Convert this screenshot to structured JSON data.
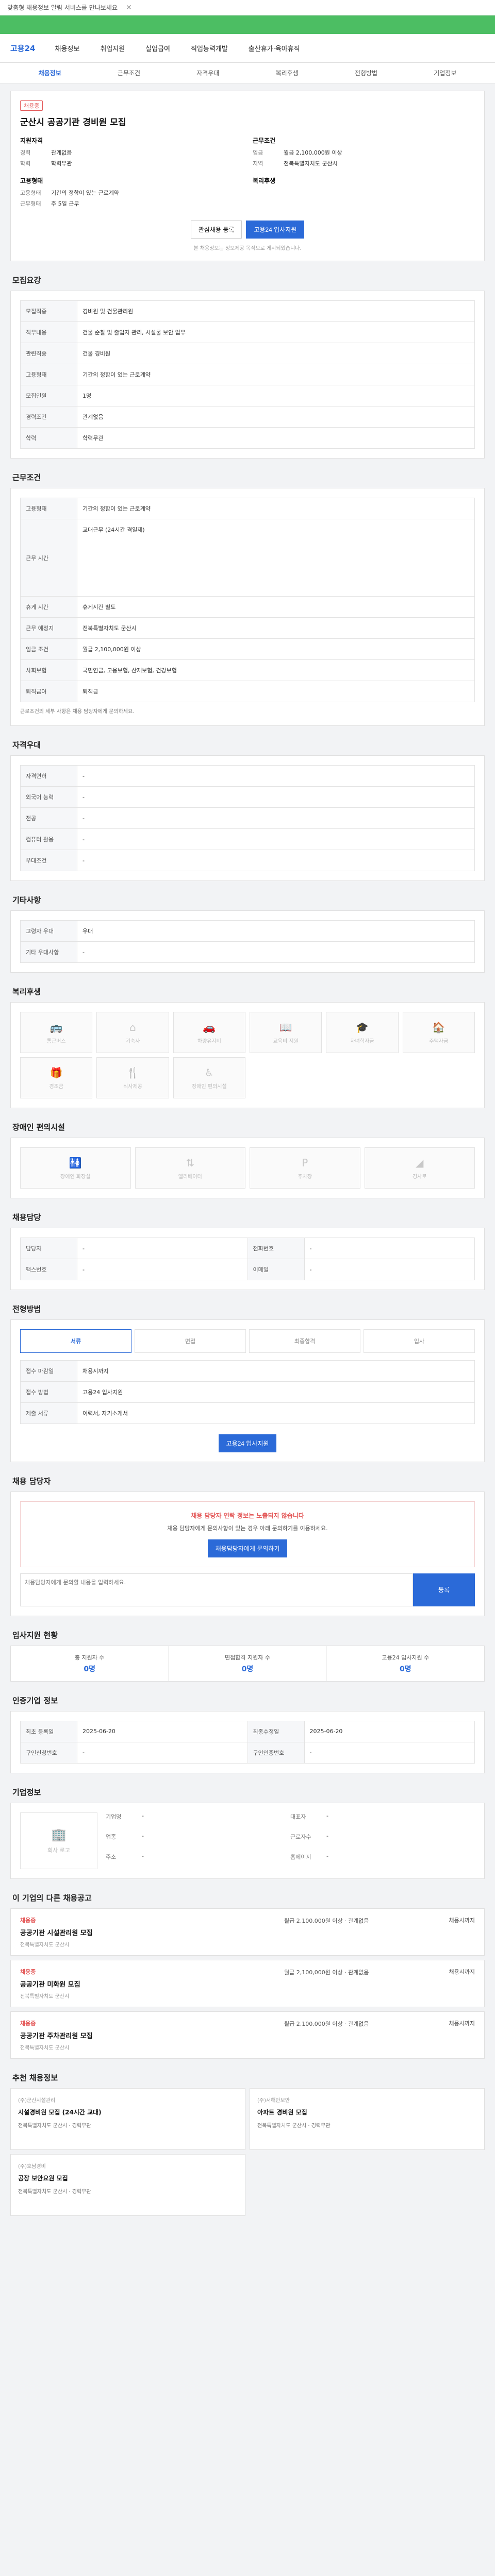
{
  "topbar": {
    "notice": "맞춤형 채용정보 알림 서비스를 만나보세요",
    "close": "✕"
  },
  "nav": {
    "logo": "고용24",
    "menus": [
      "채용정보",
      "취업지원",
      "실업급여",
      "직업능력개발",
      "출산휴가·육아휴직"
    ]
  },
  "subnav": {
    "items": [
      "채용정보",
      "근무조건",
      "자격우대",
      "복리후생",
      "전형방법",
      "기업정보"
    ],
    "active": 0
  },
  "job": {
    "badge": "채용중",
    "title": "군산시 공공기관 경비원 모집",
    "left_title": "지원자격",
    "left_rows": [
      {
        "k": "경력",
        "v": "관계없음"
      },
      {
        "k": "학력",
        "v": "학력무관"
      }
    ],
    "right_title": "근무조건",
    "right_rows": [
      {
        "k": "임금",
        "v": "월급 2,100,000원 이상"
      },
      {
        "k": "지역",
        "v": "전북특별자치도 군산시"
      }
    ],
    "left_title2": "고용형태",
    "left_rows2": [
      {
        "k": "고용형태",
        "v": "기간의 정함이 있는 근로계약"
      },
      {
        "k": "근무형태",
        "v": "주 5일 근무"
      }
    ],
    "right_title2": "복리후생",
    "btn_scrap": "관심채용 등록",
    "btn_apply": "고용24 입사지원",
    "note": "본 채용정보는 정보제공 목적으로 게시되었습니다."
  },
  "recruit": {
    "title": "모집요강",
    "rows": [
      {
        "k": "모집직종",
        "v": "경비원 및 건물관리원"
      },
      {
        "k": "직무내용",
        "v": "건물 순찰 및 출입자 관리, 시설물 보안 업무"
      },
      {
        "k": "관련직종",
        "v": "건물 경비원"
      },
      {
        "k": "고용형태",
        "v": "기간의 정함이 있는 근로계약"
      },
      {
        "k": "모집인원",
        "v": "1명"
      },
      {
        "k": "경력조건",
        "v": "관계없음"
      },
      {
        "k": "학력",
        "v": "학력무관"
      }
    ]
  },
  "conditions": {
    "title": "근무조건",
    "rows": [
      {
        "k": "고용형태",
        "v": "기간의 정함이 있는 근로계약"
      },
      {
        "k": "근무 시간",
        "v": "교대근무 (24시간 격일제)"
      },
      {
        "k": "휴게 시간",
        "v": "휴게시간 별도"
      },
      {
        "k": "근무 예정지",
        "v": "전북특별자치도 군산시"
      },
      {
        "k": "임금 조건",
        "v": "월급 2,100,000원 이상"
      },
      {
        "k": "사회보험",
        "v": "국민연금, 고용보험, 산재보험, 건강보험"
      },
      {
        "k": "퇴직급여",
        "v": "퇴직금"
      }
    ],
    "note": "근로조건의 세부 사항은 채용 담당자에게 문의하세요."
  },
  "qualification": {
    "title": "자격우대",
    "rows": [
      {
        "k": "자격면허",
        "v": "-"
      },
      {
        "k": "외국어 능력",
        "v": "-"
      },
      {
        "k": "전공",
        "v": "-"
      },
      {
        "k": "컴퓨터 활용",
        "v": "-"
      },
      {
        "k": "우대조건",
        "v": "-"
      }
    ]
  },
  "other": {
    "title": "기타사항",
    "rows": [
      {
        "k": "고령자 우대",
        "v": "우대"
      },
      {
        "k": "기타 우대사항",
        "v": "-"
      }
    ]
  },
  "benefits": {
    "title": "복리후생",
    "items": [
      "통근버스",
      "기숙사",
      "차량유지비",
      "교육비 지원",
      "자녀학자금",
      "주택자금",
      "경조금",
      "식사제공",
      "장애인 편의시설"
    ]
  },
  "disability": {
    "title": "장애인 편의시설",
    "items": [
      "장애인 화장실",
      "엘리베이터",
      "주차장",
      "경사로"
    ]
  },
  "worker": {
    "title": "채용담당",
    "rows": [
      {
        "k": "담당자",
        "v": "-"
      },
      {
        "k": "전화번호",
        "v": "-"
      },
      {
        "k": "팩스번호",
        "v": "-"
      },
      {
        "k": "이메일",
        "v": "-"
      }
    ]
  },
  "process": {
    "title": "전형방법",
    "steps": [
      "서류",
      "면접",
      "최종합격",
      "입사"
    ],
    "active": 0,
    "rows": [
      {
        "k": "접수 마감일",
        "v": "채용시까지"
      },
      {
        "k": "접수 방법",
        "v": "고용24 입사지원"
      },
      {
        "k": "제출 서류",
        "v": "이력서, 자기소개서"
      }
    ],
    "apply": "고용24 입사지원"
  },
  "contact": {
    "title": "채용 담당자",
    "warn": "채용 담당자 연락 정보는 노출되지 않습니다",
    "msg": "채용 담당자에게 문의사항이 있는 경우 아래 문의하기를 이용하세요.",
    "btn_inquiry": "채용담당자에게 문의하기",
    "qa_placeholder": "채용담당자에게 문의할 내용을 입력하세요.",
    "qa_btn": "등록"
  },
  "apply_status": {
    "title": "입사지원 현황",
    "stats": [
      {
        "label": "총 지원자 수",
        "num": "0명"
      },
      {
        "label": "면접합격 지원자 수",
        "num": "0명"
      },
      {
        "label": "고용24 입사지원 수",
        "num": "0명"
      }
    ]
  },
  "job_info": {
    "title": "인증기업 정보",
    "rows": [
      {
        "k": "최초 등록일",
        "v": "2025-06-20"
      },
      {
        "k": "구인신청번호",
        "v": "-"
      },
      {
        "k": "최종수정일",
        "v": "2025-06-20"
      },
      {
        "k": "구인인증번호",
        "v": "-"
      }
    ]
  },
  "company": {
    "title": "기업정보",
    "logo": "회사 로고",
    "rows": [
      {
        "k": "기업명",
        "v": "-"
      },
      {
        "k": "대표자",
        "v": "-"
      },
      {
        "k": "업종",
        "v": "-"
      },
      {
        "k": "근로자수",
        "v": "-"
      },
      {
        "k": "주소",
        "v": "-"
      },
      {
        "k": "홈페이지",
        "v": "-"
      }
    ]
  },
  "similar": {
    "title": "이 기업의 다른 채용공고",
    "jobs": [
      {
        "tag": "채용중",
        "title": "공공기관 시설관리원 모집",
        "sub": "전북특별자치도 군산시",
        "mid": "월급 2,100,000원 이상 · 관계없음",
        "right": "채용시까지"
      },
      {
        "tag": "채용중",
        "title": "공공기관 미화원 모집",
        "sub": "전북특별자치도 군산시",
        "mid": "월급 2,100,000원 이상 · 관계없음",
        "right": "채용시까지"
      },
      {
        "tag": "채용중",
        "title": "공공기관 주차관리원 모집",
        "sub": "전북특별자치도 군산시",
        "mid": "월급 2,100,000원 이상 · 관계없음",
        "right": "채용시까지"
      }
    ]
  },
  "recommend": {
    "title": "추천 채용정보",
    "items": [
      {
        "comp": "(주)군산시설관리",
        "title": "시설경비원 모집 (24시간 교대)",
        "meta": "전북특별자치도 군산시 · 경력무관"
      },
      {
        "comp": "(주)서해안보안",
        "title": "아파트 경비원 모집",
        "meta": "전북특별자치도 군산시 · 경력무관"
      },
      {
        "comp": "(주)호남경비",
        "title": "공장 보안요원 모집",
        "meta": "전북특별자치도 군산시 · 경력무관"
      }
    ]
  }
}
